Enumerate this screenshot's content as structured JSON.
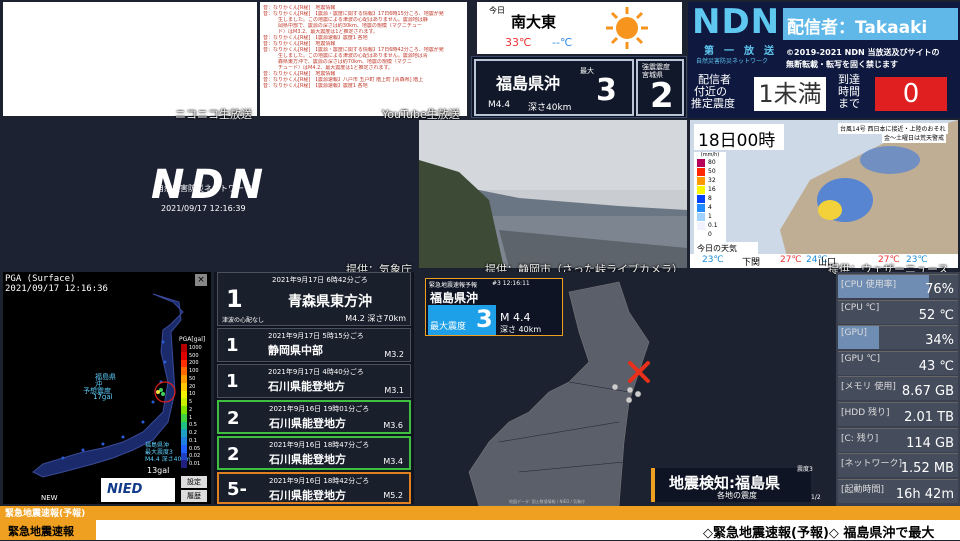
{
  "captions": {
    "niconico": "ニコニコ生放送",
    "youtube": "YouTube生放送",
    "jma": "提供：気象庁",
    "shizuoka": "提供：静岡市（さった峠ライブカメラ）",
    "wn": "提供：ウェザーニュース"
  },
  "log_lines": [
    "音：なりかくん[R秘]　地震情報",
    "音：なりかくん[R秘]　【震源・震度に関する情報】17日6時15分ころ、地震が発",
    "　　　生しました。この地震による津波の心配はありません。震源地は静",
    "　　　岡県中部で、震源の深さは約30km、地震の規模（マグニチュー",
    "　　　ド）はM3.2、最大震度は1と推定されます。",
    "音：なりかくん[R秘]　【震源速報】震度1 各地",
    "音：なりかくん[R秘]　地震情報",
    "音：なりかくん[R秘]　【震源・震度に関する情報】17日6時42分ころ、地震が発",
    "　　　生しました。この地震による津波の心配はありません。震源地は青",
    "　　　森県東方沖で、震源の深さは約70km、地震の規模（マグニ",
    "　　　チュード）はM4.2、最大震度は1と推定されます。",
    "音：なりかくん[R秘]　地震情報",
    "音：なりかくん[R秘]　【震源速報】八戸市 五戸町 階上町 [青森県] 階上",
    "音：なりかくん[R秘]　【震源速報】震度1 各地"
  ],
  "ndn_logo": {
    "text": "NDN",
    "sub": "自然災害防災ネットワーク",
    "datetime": "2021/09/17 12:16:39"
  },
  "weather": {
    "today": "今日",
    "wind": "南大東",
    "temp_hi": "33℃",
    "temp_lo": "--℃"
  },
  "quake_top": {
    "place": "福島県沖",
    "max_label": "最大",
    "max_value": "3",
    "mag": "M4.4",
    "depth": "深さ40km",
    "obs_label1": "強震震度",
    "obs_label2": "宮城県",
    "obs_value": "2"
  },
  "header": {
    "logo": "NDN",
    "tag": "第　一　放　送",
    "tag_sub": "自然災害防災ネットワーク",
    "broadcaster": "配信者：Takaaki",
    "copyright1": "©2019-2021 NDN 当放送及びサイトの",
    "copyright2": "無断転載・転写を固く禁じます"
  },
  "estimate": {
    "label1": "配信者",
    "label2": "付近の",
    "label3": "推定震度",
    "value": "1未満",
    "arrival_label1": "到達",
    "arrival_label2": "時間",
    "arrival_label3": "まで",
    "arrival_value": "0"
  },
  "forecast": {
    "time": "18日00時",
    "headline": "台風14号 西日本に接近・上陸のおそれ",
    "headline2": "金〜土曜日は荒天警戒",
    "legend_title": "(mm/h)",
    "legend": [
      "80",
      "50",
      "32",
      "16",
      "8",
      "4",
      "1",
      "0.1",
      "0"
    ],
    "today_label": "今日の天気",
    "cities": [
      {
        "name": "下関",
        "hi": "27℃",
        "lo": "24℃",
        "tmp": "23℃"
      },
      {
        "name": "山口",
        "hi": "27℃",
        "lo": "23℃"
      }
    ],
    "left_tmp": "23℃"
  },
  "pga": {
    "title": "PGA (Surface)",
    "datetime": "2021/09/17 12:16:36",
    "axis": "PGA[gal]",
    "scale": [
      "1000",
      "500",
      "200",
      "100",
      "50",
      "20",
      "10",
      "5",
      "2",
      "1",
      "0.5",
      "0.2",
      "0.1",
      "0.05",
      "0.02",
      "0.01"
    ],
    "label_a1": "福島県",
    "label_a2": "沖",
    "label_a3": "予想震度",
    "label_a4": "17gal",
    "label_b1": "福島県沖",
    "label_b2": "最大震度3",
    "label_b3": "M4.4 深さ40km",
    "gal": "13gal",
    "new": "NEW",
    "nied": "NIED",
    "settings": "設定",
    "history": "履歴"
  },
  "eq_list": [
    {
      "int": "1",
      "date": "2021年9月17日 6時42分ごろ",
      "place": "青森県東方沖",
      "note": "津波の心配なし",
      "mag": "M4.2 深さ70km"
    },
    {
      "int": "1",
      "date": "2021年9月17日 5時15分ごろ",
      "place": "静岡県中部",
      "mag": "M3.2"
    },
    {
      "int": "1",
      "date": "2021年9月17日 4時40分ごろ",
      "place": "石川県能登地方",
      "mag": "M3.1"
    },
    {
      "int": "2",
      "date": "2021年9月16日 19時01分ごろ",
      "place": "石川県能登地方",
      "mag": "M3.6"
    },
    {
      "int": "2",
      "date": "2021年9月16日 18時47分ごろ",
      "place": "石川県能登地方",
      "mag": "M3.4"
    },
    {
      "int": "5-",
      "date": "2021年9月16日 18時42分ごろ",
      "place": "石川県能登地方",
      "mag": "M5.2"
    }
  ],
  "eew": {
    "header": "緊急地震速報予報",
    "serial": "#3 12:16:11",
    "place": "福島県沖",
    "max_label": "最大震度",
    "max": "3",
    "mag": "M 4.4",
    "depth": "深さ 40km",
    "detect": "地震検知:福島県",
    "detect_sub": "各地の震度",
    "mini_label": "震度3",
    "mini_page": "1/2",
    "footer": "地図データ: 国土数値情報 / NIED / 気象庁"
  },
  "stats": [
    {
      "label": "[CPU 使用率]",
      "value": "76%",
      "pct": 76
    },
    {
      "label": "[CPU ℃]",
      "value": "52 ℃",
      "pct": 0
    },
    {
      "label": "[GPU]",
      "value": "34%",
      "pct": 34
    },
    {
      "label": "[GPU ℃]",
      "value": "43 ℃",
      "pct": 0
    },
    {
      "label": "[メモリ 使用]",
      "value": "8.67 GB",
      "pct": 0
    },
    {
      "label": "[HDD 残り]",
      "value": "2.01 TB",
      "pct": 0
    },
    {
      "label": "[C: 残り]",
      "value": "114 GB",
      "pct": 0
    },
    {
      "label": "[ネットワーク]",
      "value": "1.52 MB",
      "pct": 0
    },
    {
      "label": "[起動時間]",
      "value": "16h 42m",
      "pct": 0
    }
  ],
  "bottom": {
    "strip": "緊急地震速報(予報)",
    "badge": "緊急地震速報",
    "ticker": "◇緊急地震速報(予報)◇ 福島県沖で最大"
  },
  "colors": {
    "accent": "#f0a020",
    "eew_blue": "#1ea0e8",
    "red": "#e02020"
  }
}
